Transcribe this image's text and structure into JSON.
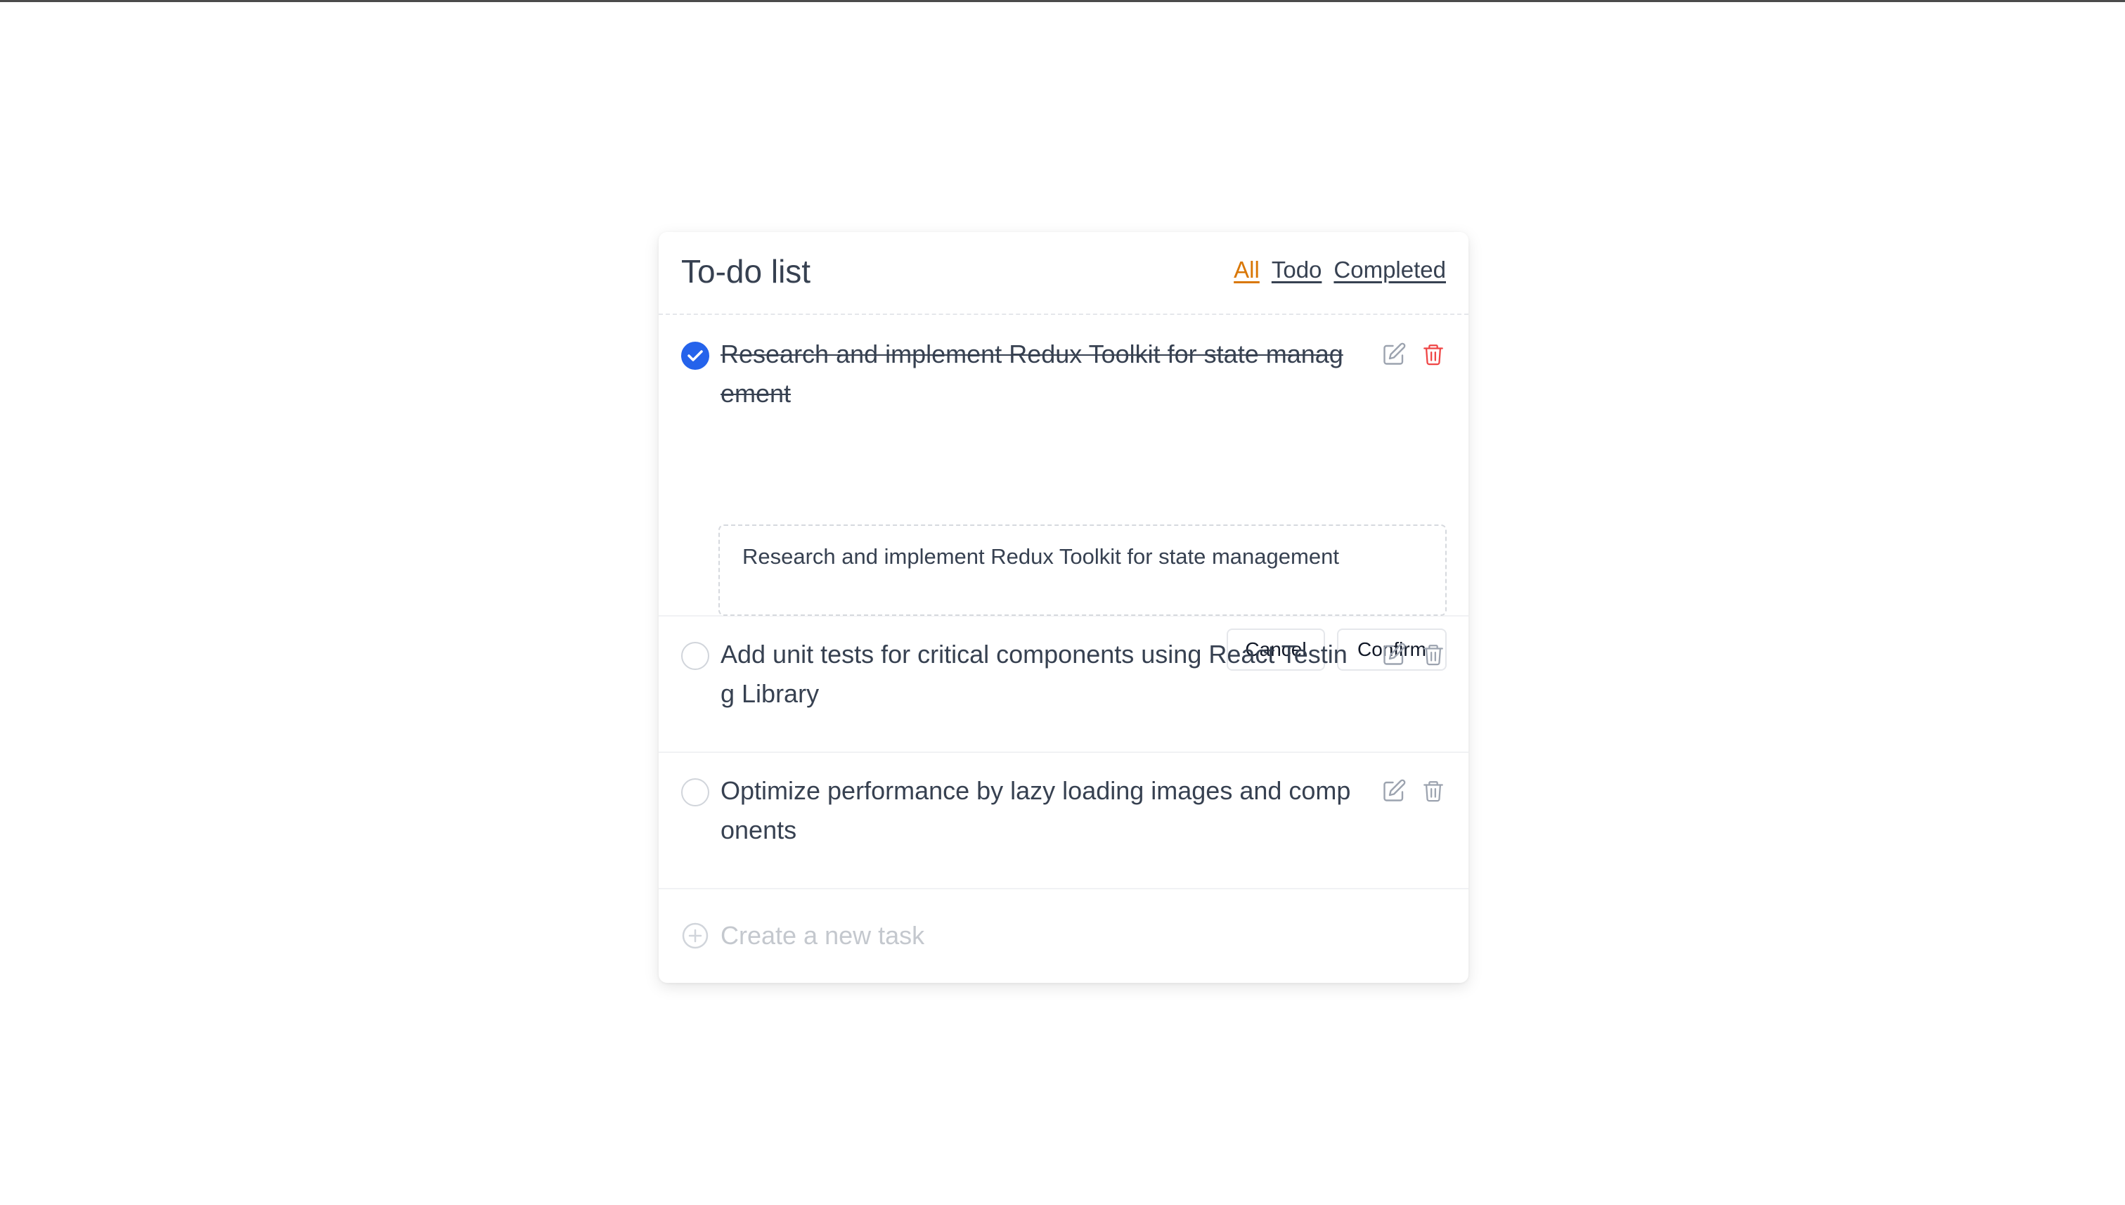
{
  "title": "To-do list",
  "filters": {
    "all": "All",
    "todo": "Todo",
    "completed": "Completed",
    "active": "All"
  },
  "tasks": [
    {
      "text": "Research and implement Redux Toolkit for state management",
      "completed": true,
      "editing": true,
      "edit_value": "Research and implement Redux Toolkit for state management"
    },
    {
      "text": "Add unit tests for critical components using React Testing Library",
      "completed": false,
      "editing": false
    },
    {
      "text": "Optimize performance by lazy loading images and components",
      "completed": false,
      "editing": false
    }
  ],
  "editor": {
    "cancel_label": "Cancel",
    "confirm_label": "Confirm"
  },
  "new_task": {
    "placeholder": "Create a new task",
    "value": ""
  },
  "colors": {
    "accent": "#d97706",
    "check": "#2563eb",
    "delete_active": "#ef4444",
    "icon": "#9ca3af",
    "text": "#374151"
  },
  "icons": {
    "edit": "edit-icon",
    "delete": "trash-icon",
    "check": "check-circle-icon",
    "add": "plus-circle-icon"
  }
}
